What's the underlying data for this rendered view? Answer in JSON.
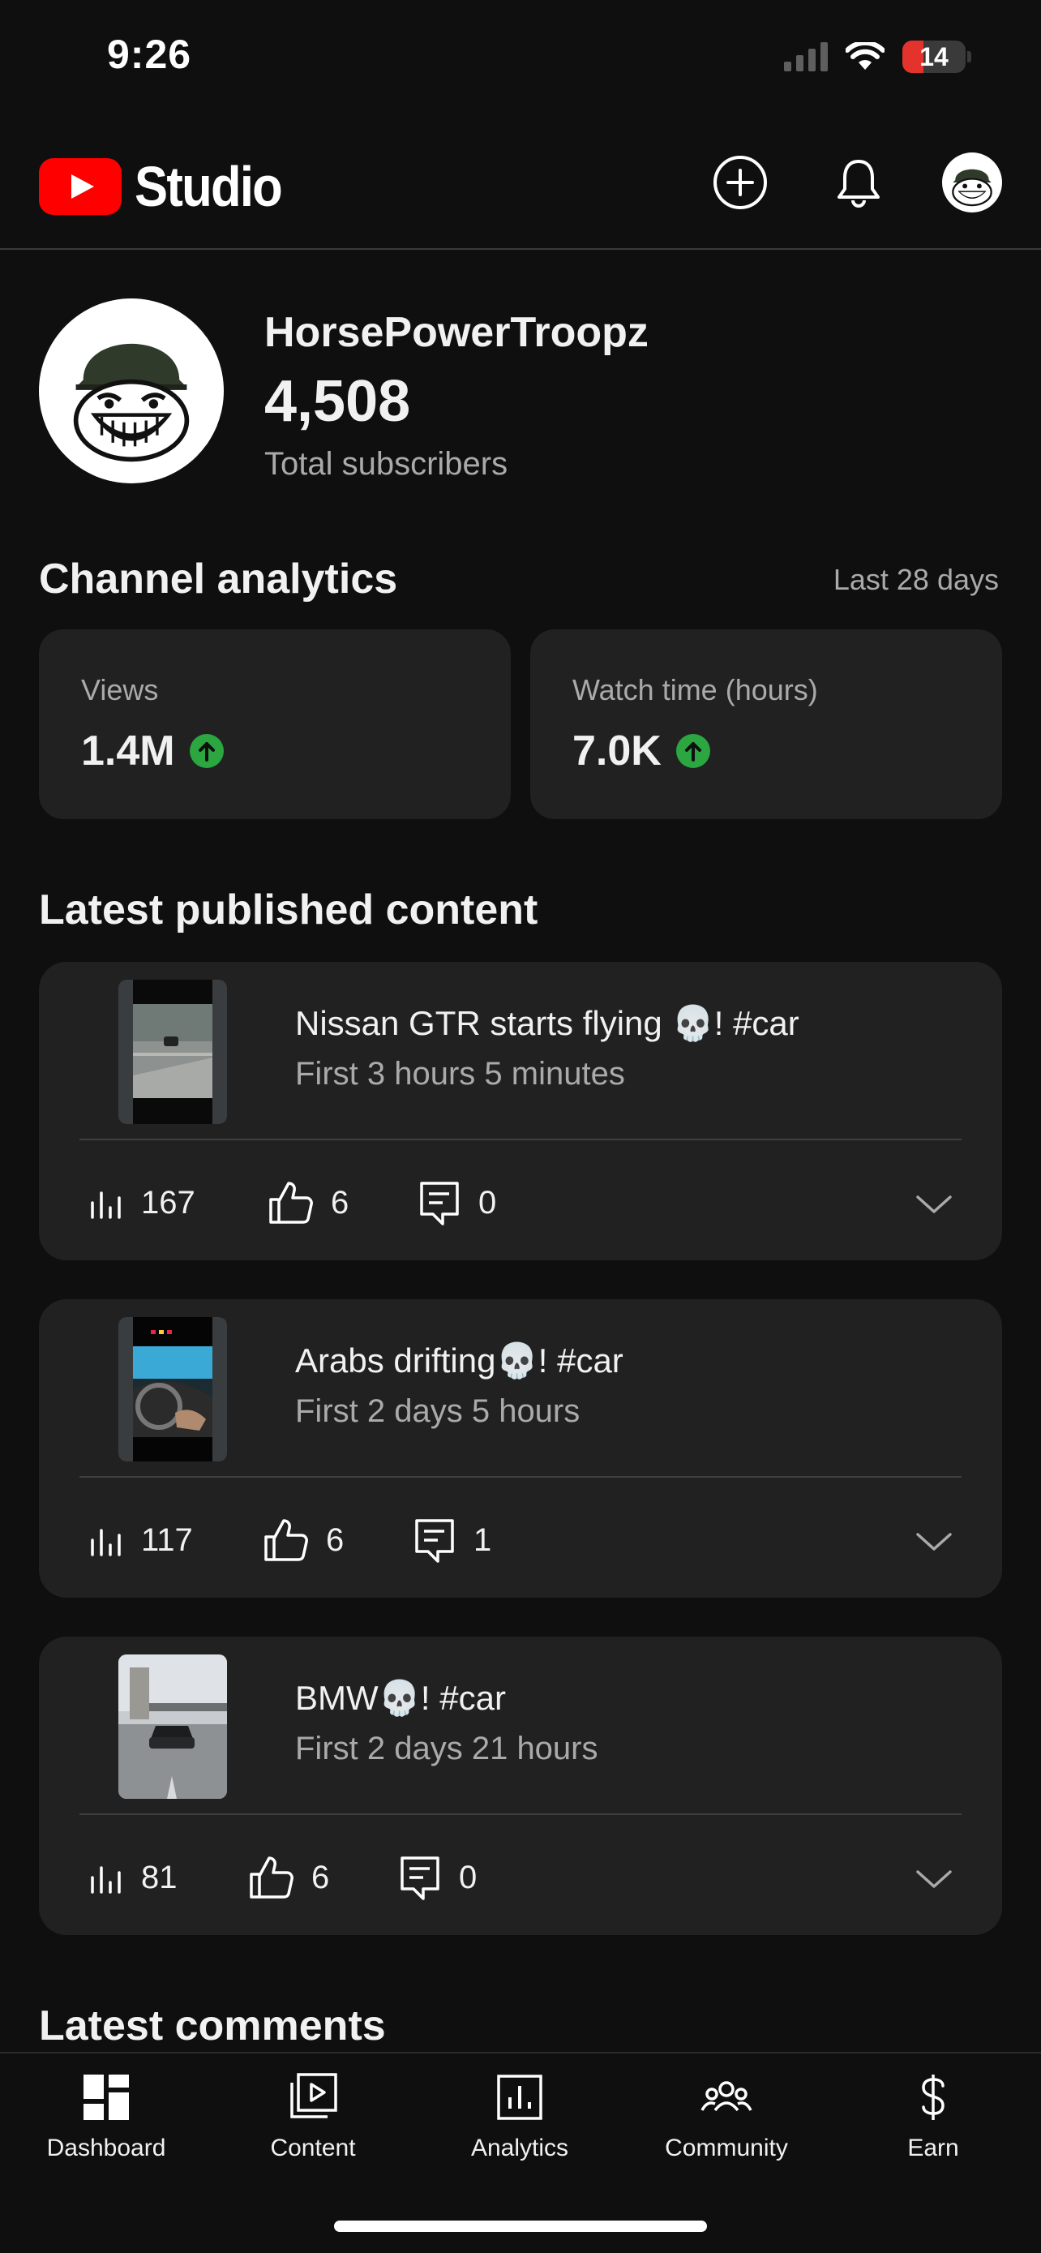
{
  "status_bar": {
    "time": "9:26",
    "battery": "14",
    "battery_level": 0.14,
    "battery_color": "#e4332c"
  },
  "header": {
    "app_name": "Studio",
    "brand_color": "#ff0000",
    "icons": [
      "add-circle-icon",
      "bell-icon",
      "account-avatar"
    ]
  },
  "channel": {
    "name": "HorsePowerTroopz",
    "subscribers": "4,508",
    "subscribers_label": "Total subscribers"
  },
  "analytics": {
    "title": "Channel analytics",
    "period": "Last 28 days",
    "cards": [
      {
        "label": "Views",
        "value": "1.4M",
        "trend": "up"
      },
      {
        "label": "Watch time (hours)",
        "value": "7.0K",
        "trend": "up"
      }
    ],
    "trend_color": "#2ba640"
  },
  "latest_content": {
    "title": "Latest published content",
    "videos": [
      {
        "title": "Nissan GTR starts flying 💀! #car",
        "meta": "First 3 hours 5 minutes",
        "views": "167",
        "likes": "6",
        "comments": "0"
      },
      {
        "title": "Arabs drifting💀! #car",
        "meta": "First 2 days 5 hours",
        "views": "117",
        "likes": "6",
        "comments": "1"
      },
      {
        "title": "BMW💀! #car",
        "meta": "First 2 days 21 hours",
        "views": "81",
        "likes": "6",
        "comments": "0"
      }
    ]
  },
  "latest_comments": {
    "title": "Latest comments"
  },
  "bottom_nav": {
    "items": [
      {
        "label": "Dashboard",
        "icon": "dashboard-icon"
      },
      {
        "label": "Content",
        "icon": "content-icon"
      },
      {
        "label": "Analytics",
        "icon": "analytics-icon"
      },
      {
        "label": "Community",
        "icon": "community-icon"
      },
      {
        "label": "Earn",
        "icon": "dollar-icon"
      }
    ]
  }
}
